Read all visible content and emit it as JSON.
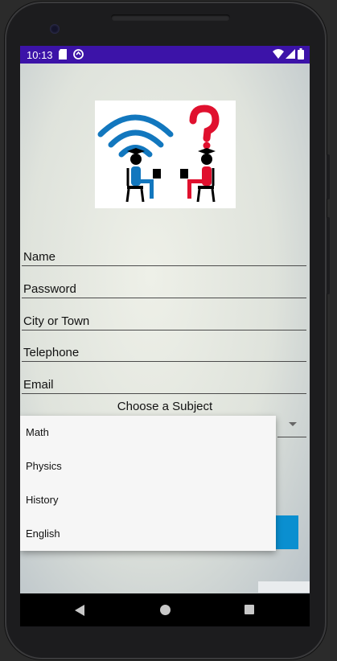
{
  "status_bar": {
    "time": "10:13",
    "icons": [
      "sd-card-icon",
      "sync-icon",
      "wifi-icon",
      "signal-icon",
      "battery-icon"
    ]
  },
  "form": {
    "fields": [
      {
        "placeholder": "Name"
      },
      {
        "placeholder": "Password"
      },
      {
        "placeholder": "City or Town"
      },
      {
        "placeholder": "Telephone"
      },
      {
        "placeholder": "Email"
      }
    ],
    "subject_label": "Choose a Subject"
  },
  "dropdown": {
    "options": [
      "Math",
      "Physics",
      "History",
      "English"
    ]
  },
  "colors": {
    "status_bar": "#3c13a8",
    "accent": "#0a8fd0",
    "logo_blue": "#1277be",
    "logo_red": "#e0102e"
  }
}
